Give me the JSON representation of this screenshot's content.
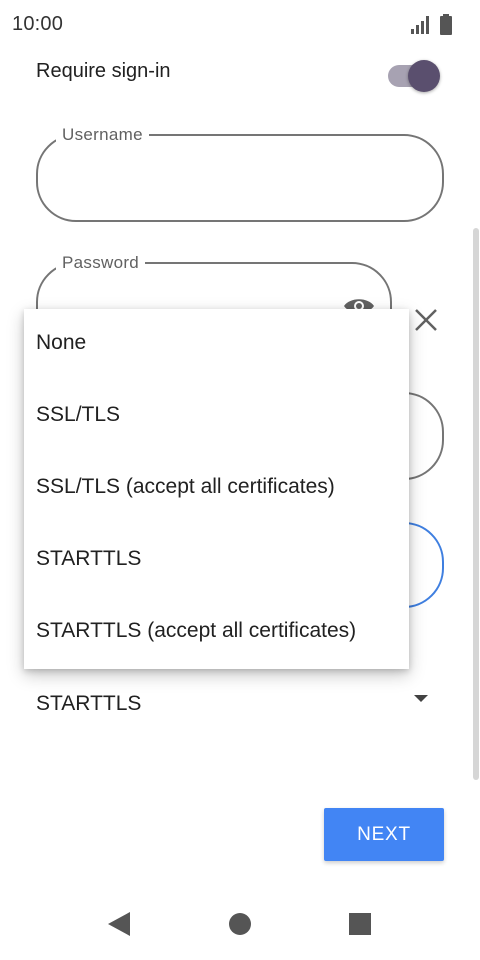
{
  "status_bar": {
    "time": "10:00",
    "icons": [
      "signal-icon",
      "battery-icon"
    ]
  },
  "form": {
    "require_signin_label": "Require sign-in",
    "require_signin_on": true,
    "username": {
      "label": "Username",
      "value": ""
    },
    "password": {
      "label": "Password",
      "value": ""
    },
    "security": {
      "selected": "STARTTLS"
    }
  },
  "dropdown": {
    "options": [
      "None",
      "SSL/TLS",
      "SSL/TLS (accept all certificates)",
      "STARTTLS",
      "STARTTLS (accept all certificates)"
    ]
  },
  "actions": {
    "next_label": "NEXT"
  },
  "nav_bar": {
    "icons": [
      "back-icon",
      "home-icon",
      "recents-icon"
    ]
  },
  "colors": {
    "accent": "#4285f4",
    "switch_thumb": "#5a4f6e",
    "focused_outline": "#3f7fe0"
  }
}
